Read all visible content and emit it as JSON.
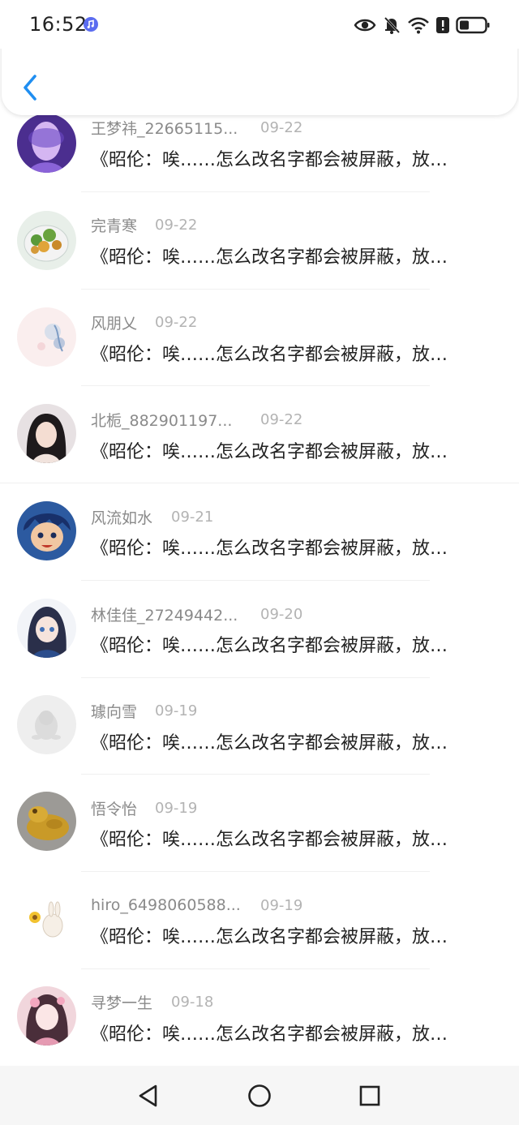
{
  "status_bar": {
    "time": "16:52",
    "icons": [
      "music-app-icon",
      "eye-icon",
      "bell-muted-icon",
      "wifi-icon",
      "alert-icon",
      "battery-icon"
    ]
  },
  "header": {
    "back_icon": "chevron-left-icon",
    "accent_color": "#1f8ef1"
  },
  "items": [
    {
      "name": "王梦祎_22665115...",
      "date": "09-22",
      "message": "《昭伦：唉……怎么改名字都会被屏蔽，放…",
      "avatar": "purple-face-avatar"
    },
    {
      "name": "完青寒",
      "date": "09-22",
      "message": "《昭伦：唉……怎么改名字都会被屏蔽，放…",
      "avatar": "salad-bowl-avatar"
    },
    {
      "name": "风朋乂",
      "date": "09-22",
      "message": "《昭伦：唉……怎么改名字都会被屏蔽，放…",
      "avatar": "pink-floral-avatar"
    },
    {
      "name": "北栀_882901197...",
      "date": "09-22",
      "message": "《昭伦：唉……怎么改名字都会被屏蔽，放…",
      "avatar": "girl-portrait-avatar"
    },
    {
      "name": "风流如水",
      "date": "09-21",
      "message": "《昭伦：唉……怎么改名字都会被屏蔽，放…",
      "avatar": "anime-boy-avatar"
    },
    {
      "name": "林佳佳_27249442...",
      "date": "09-20",
      "message": "《昭伦：唉……怎么改名字都会被屏蔽，放…",
      "avatar": "anime-girl-avatar"
    },
    {
      "name": "璩向雪",
      "date": "09-19",
      "message": "《昭伦：唉……怎么改名字都会被屏蔽，放…",
      "avatar": "default-penguin-avatar"
    },
    {
      "name": "悟令怡",
      "date": "09-19",
      "message": "《昭伦：唉……怎么改名字都会被屏蔽，放…",
      "avatar": "golden-toad-avatar"
    },
    {
      "name": "hiro_6498060588...",
      "date": "09-19",
      "message": "《昭伦：唉……怎么改名字都会被屏蔽，放…",
      "avatar": "bunny-sunflower-avatar"
    },
    {
      "name": "寻梦一生",
      "date": "09-18",
      "message": "《昭伦：唉……怎么改名字都会被屏蔽，放…",
      "avatar": "anime-flower-girl-avatar"
    }
  ],
  "nav_bar": {
    "buttons": [
      "back-triangle-icon",
      "home-circle-icon",
      "recents-square-icon"
    ]
  }
}
